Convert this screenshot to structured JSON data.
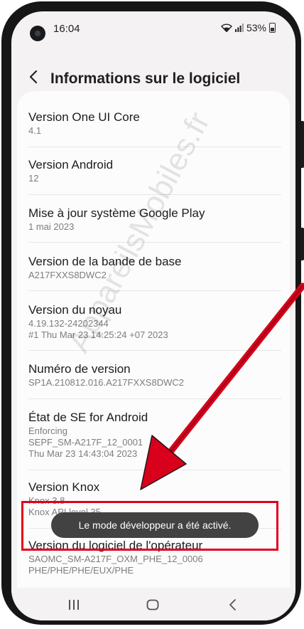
{
  "status_bar": {
    "time": "16:04",
    "battery": "53%"
  },
  "header": {
    "title": "Informations sur le logiciel"
  },
  "items": [
    {
      "title": "Version One UI Core",
      "value": "4.1"
    },
    {
      "title": "Version Android",
      "value": "12"
    },
    {
      "title": "Mise à jour système Google Play",
      "value": "1 mai 2023"
    },
    {
      "title": "Version de la bande de base",
      "value": "A217FXXS8DWC2"
    },
    {
      "title": "Version du noyau",
      "value": "4.19.132-24202344",
      "value2": "#1 Thu Mar 23 14:25:24 +07 2023"
    },
    {
      "title": "Numéro de version",
      "value": "SP1A.210812.016.A217FXXS8DWC2"
    },
    {
      "title": "État de SE for Android",
      "value": "Enforcing",
      "value2": "SEPF_SM-A217F_12_0001",
      "value3": "Thu Mar 23 14:43:04 2023"
    },
    {
      "title": "Version Knox",
      "value": "Knox 3.8",
      "value2": "Knox API level 35"
    },
    {
      "title": "Version du logiciel de l'opérateur",
      "value": "SAOMC_SM-A217F_OXM_PHE_12_0006",
      "value2": "PHE/PHE/PHE/EUX/PHE"
    }
  ],
  "toast": {
    "message": "Le mode développeur a été activé."
  },
  "watermark": {
    "text": "AppareilsMobiles.fr"
  },
  "colors": {
    "highlight": "#e3001b",
    "arrow": "#d8001a",
    "toast_bg": "#424242"
  },
  "icons": {
    "back": "chevron-left-icon",
    "recents": "recent-apps-icon",
    "home": "home-icon",
    "nav_back": "back-icon"
  }
}
